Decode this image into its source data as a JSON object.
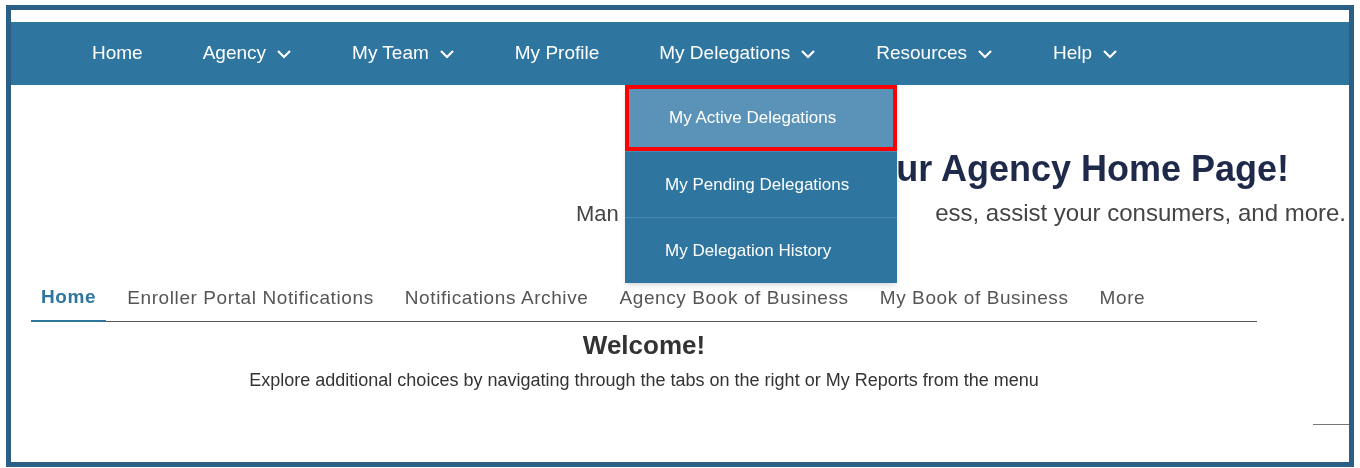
{
  "nav": [
    {
      "label": "Home",
      "dropdown": false
    },
    {
      "label": "Agency",
      "dropdown": true
    },
    {
      "label": "My Team",
      "dropdown": true
    },
    {
      "label": "My Profile",
      "dropdown": false
    },
    {
      "label": "My Delegations",
      "dropdown": true
    },
    {
      "label": "Resources",
      "dropdown": true
    },
    {
      "label": "Help",
      "dropdown": true
    }
  ],
  "dropdown_menu": [
    {
      "label": "My Active Delegations",
      "selected": true,
      "highlighted": true
    },
    {
      "label": "My Pending Delegations",
      "selected": false,
      "highlighted": false
    },
    {
      "label": "My Delegation History",
      "selected": false,
      "highlighted": false
    }
  ],
  "heading": "ur Agency Home Page!",
  "subtitle_parts": [
    "Man",
    "ess, assist your consumers, and more."
  ],
  "tabs": [
    {
      "label": "Home",
      "selected": true
    },
    {
      "label": "Enroller Portal Notifications",
      "selected": false
    },
    {
      "label": "Notifications Archive",
      "selected": false
    },
    {
      "label": "Agency Book of Business",
      "selected": false
    },
    {
      "label": "My Book of Business",
      "selected": false
    },
    {
      "label": "More",
      "selected": false
    }
  ],
  "welcome": {
    "title": "Welcome!",
    "text": "Explore additional choices by navigating through the tabs on the right or My Reports from the menu"
  }
}
